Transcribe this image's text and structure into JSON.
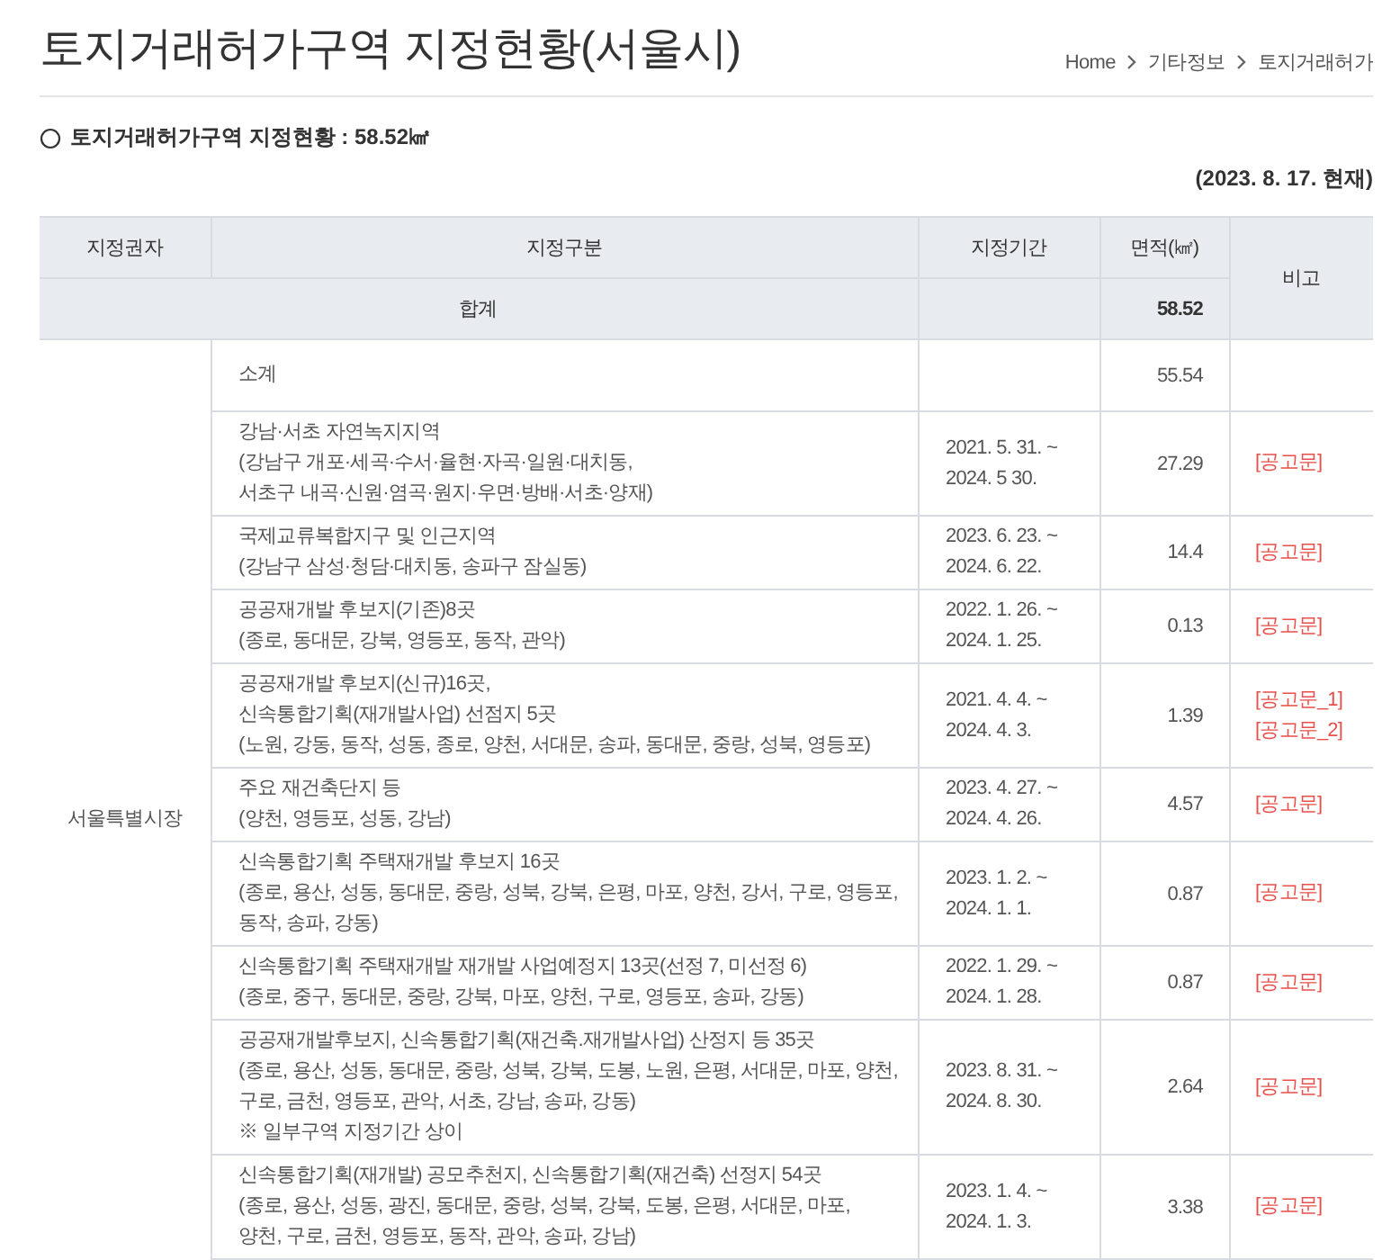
{
  "page_title": "토지거래허가구역 지정현황(서울시)",
  "breadcrumb": [
    "Home",
    "기타정보",
    "토지거래허가"
  ],
  "summary": "토지거래허가구역 지정현황 : 58.52㎢",
  "as_of": "(2023. 8. 17. 현재)",
  "table": {
    "columns": [
      "지정권자",
      "지정구분",
      "지정기간",
      "면적(㎢)",
      "비고"
    ],
    "total": {
      "label": "합계",
      "area": "58.52"
    },
    "authority": "서울특별시장",
    "subtotal": {
      "label": "소계",
      "area": "55.54"
    },
    "rows": [
      {
        "lines": [
          "강남·서초 자연녹지지역",
          "(강남구 개포·세곡·수서·율현·자곡·일원·대치동,",
          "서초구 내곡·신원·염곡·원지·우면·방배·서초·양재)"
        ],
        "period": [
          "2021. 5. 31. ~",
          "2024. 5 30."
        ],
        "area": "27.29",
        "notices": [
          "[공고문]"
        ]
      },
      {
        "lines": [
          "국제교류복합지구 및 인근지역",
          "(강남구 삼성·청담·대치동, 송파구 잠실동)"
        ],
        "period": [
          "2023. 6. 23. ~",
          "2024. 6. 22."
        ],
        "area": "14.4",
        "notices": [
          "[공고문]"
        ]
      },
      {
        "lines": [
          "공공재개발 후보지(기존)8곳",
          "(종로, 동대문, 강북, 영등포, 동작, 관악)"
        ],
        "period": [
          "2022. 1. 26. ~",
          "2024. 1. 25."
        ],
        "area": "0.13",
        "notices": [
          "[공고문]"
        ]
      },
      {
        "lines": [
          "공공재개발 후보지(신규)16곳,",
          "신속통합기획(재개발사업) 선점지 5곳",
          "(노원, 강동, 동작, 성동, 종로, 양천, 서대문, 송파, 동대문, 중랑, 성북, 영등포)"
        ],
        "period": [
          "2021. 4. 4. ~",
          "2024. 4. 3."
        ],
        "area": "1.39",
        "notices": [
          "[공고문_1]",
          "[공고문_2]"
        ]
      },
      {
        "lines": [
          "주요 재건축단지 등",
          "(양천, 영등포, 성동, 강남)"
        ],
        "period": [
          "2023. 4. 27. ~",
          "2024. 4. 26."
        ],
        "area": "4.57",
        "notices": [
          "[공고문]"
        ]
      },
      {
        "lines": [
          "신속통합기획 주택재개발 후보지 16곳",
          "(종로, 용산, 성동, 동대문, 중랑, 성북, 강북, 은평, 마포, 양천, 강서, 구로, 영등포,",
          "동작, 송파, 강동)"
        ],
        "period": [
          "2023. 1. 2. ~",
          "2024. 1. 1."
        ],
        "area": "0.87",
        "notices": [
          "[공고문]"
        ]
      },
      {
        "lines": [
          "신속통합기획 주택재개발 재개발 사업예정지 13곳(선정 7, 미선정 6)",
          "(종로, 중구, 동대문, 중랑, 강북, 마포, 양천, 구로, 영등포, 송파, 강동)"
        ],
        "period": [
          "2022. 1. 29. ~",
          "2024. 1. 28."
        ],
        "area": "0.87",
        "notices": [
          "[공고문]"
        ]
      },
      {
        "lines": [
          "공공재개발후보지, 신속통합기획(재건축.재개발사업) 산정지 등 35곳",
          "(종로, 용산, 성동, 동대문, 중랑, 성북, 강북, 도봉, 노원, 은평, 서대문, 마포, 양천,",
          "구로, 금천, 영등포, 관악, 서초, 강남, 송파, 강동)",
          "※ 일부구역 지정기간 상이"
        ],
        "period": [
          "2023. 8. 31. ~",
          "2024. 8. 30."
        ],
        "area": "2.64",
        "notices": [
          "[공고문]"
        ]
      },
      {
        "lines": [
          "신속통합기획(재개발) 공모추천지, 신속통합기획(재건축) 선정지 54곳",
          "(종로, 용산, 성동, 광진, 동대문, 중랑, 성북, 강북, 도봉, 은평, 서대문, 마포,",
          "양천, 구로, 금천, 영등포, 동작, 관악, 송파, 강남)"
        ],
        "period": [
          "2023. 1. 4. ~",
          "2024. 1. 3."
        ],
        "area": "3.38",
        "notices": [
          "[공고문]"
        ]
      }
    ]
  }
}
